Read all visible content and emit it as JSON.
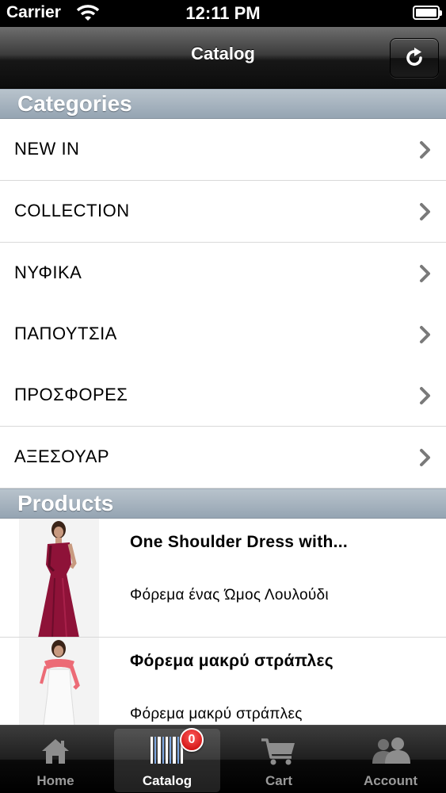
{
  "status_bar": {
    "carrier": "Carrier",
    "time": "12:11 PM"
  },
  "nav": {
    "title": "Catalog",
    "refresh_icon": "refresh-icon"
  },
  "sections": {
    "categories": "Categories",
    "products": "Products"
  },
  "categories": [
    {
      "label": "NEW IN"
    },
    {
      "label": "COLLECTION"
    },
    {
      "label": "ΝΥΦΙΚΑ"
    },
    {
      "label": "ΠΑΠΟΥΤΣΙΑ"
    },
    {
      "label": "ΠΡΟΣΦΟΡΕΣ"
    },
    {
      "label": "ΑΞΕΣΟΥΑΡ"
    }
  ],
  "products": [
    {
      "name": "One Shoulder Dress with...",
      "description": "Φόρεμα ένας Ώμος Λουλούδι"
    },
    {
      "name": "Φόρεμα μακρύ στράπλες",
      "description": "Φόρεμα μακρύ στράπλες"
    }
  ],
  "tabs": [
    {
      "label": "Home",
      "icon": "home-icon"
    },
    {
      "label": "Catalog",
      "icon": "barcode-icon"
    },
    {
      "label": "Cart",
      "icon": "cart-icon",
      "badge": "0"
    },
    {
      "label": "Account",
      "icon": "users-icon"
    }
  ],
  "colors": {
    "section_header": "#a4b1bd",
    "badge": "#d10000",
    "navbar": "#1a1a1a"
  }
}
